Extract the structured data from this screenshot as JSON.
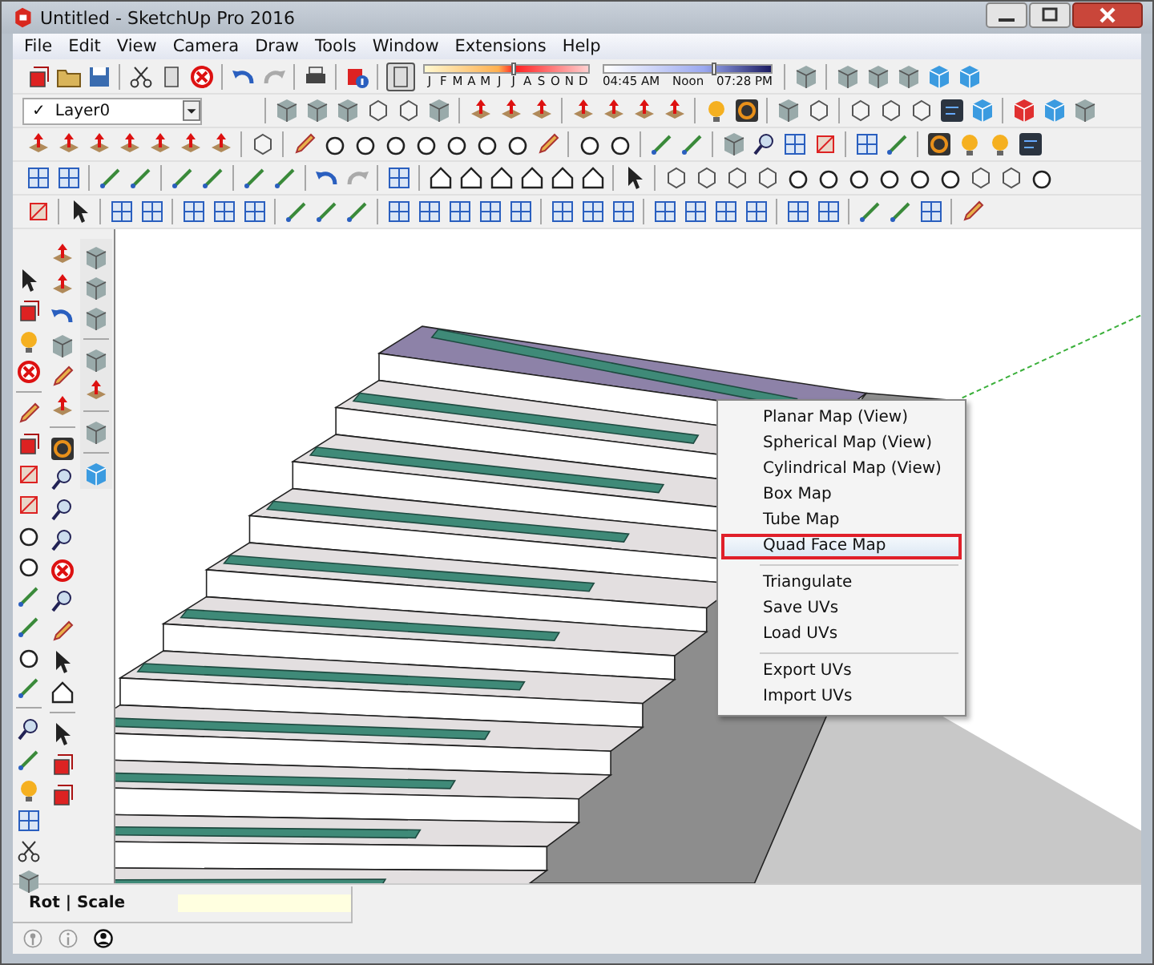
{
  "window": {
    "title": "Untitled - SketchUp Pro 2016"
  },
  "menu": [
    "File",
    "Edit",
    "View",
    "Camera",
    "Draw",
    "Tools",
    "Window",
    "Extensions",
    "Help"
  ],
  "layer_dropdown": {
    "check": "✓",
    "value": "Layer0"
  },
  "shadow_settings": {
    "months": [
      "J",
      "F",
      "M",
      "A",
      "M",
      "J",
      "J",
      "A",
      "S",
      "O",
      "N",
      "D"
    ],
    "date_slider": {
      "level": 0.54
    },
    "times": [
      "04:45 AM",
      "Noon",
      "07:28 PM"
    ],
    "time_slider": {
      "level": 0.65
    }
  },
  "context_menu": {
    "groups": [
      [
        {
          "label": "Planar Map (View)",
          "selected": false
        },
        {
          "label": "Spherical Map (View)",
          "selected": false
        },
        {
          "label": "Cylindrical Map (View)",
          "selected": false
        },
        {
          "label": "Box Map",
          "selected": false
        },
        {
          "label": "Tube Map",
          "selected": false
        },
        {
          "label": "Quad Face Map",
          "selected": true
        }
      ],
      [
        {
          "label": "Triangulate",
          "selected": false
        },
        {
          "label": "Save UVs",
          "selected": false
        },
        {
          "label": "Load UVs",
          "selected": false
        }
      ],
      [
        {
          "label": "Export UVs",
          "selected": false
        },
        {
          "label": "Import UVs",
          "selected": false
        }
      ]
    ]
  },
  "status_bar": {
    "hint": "Rot | Scale"
  }
}
